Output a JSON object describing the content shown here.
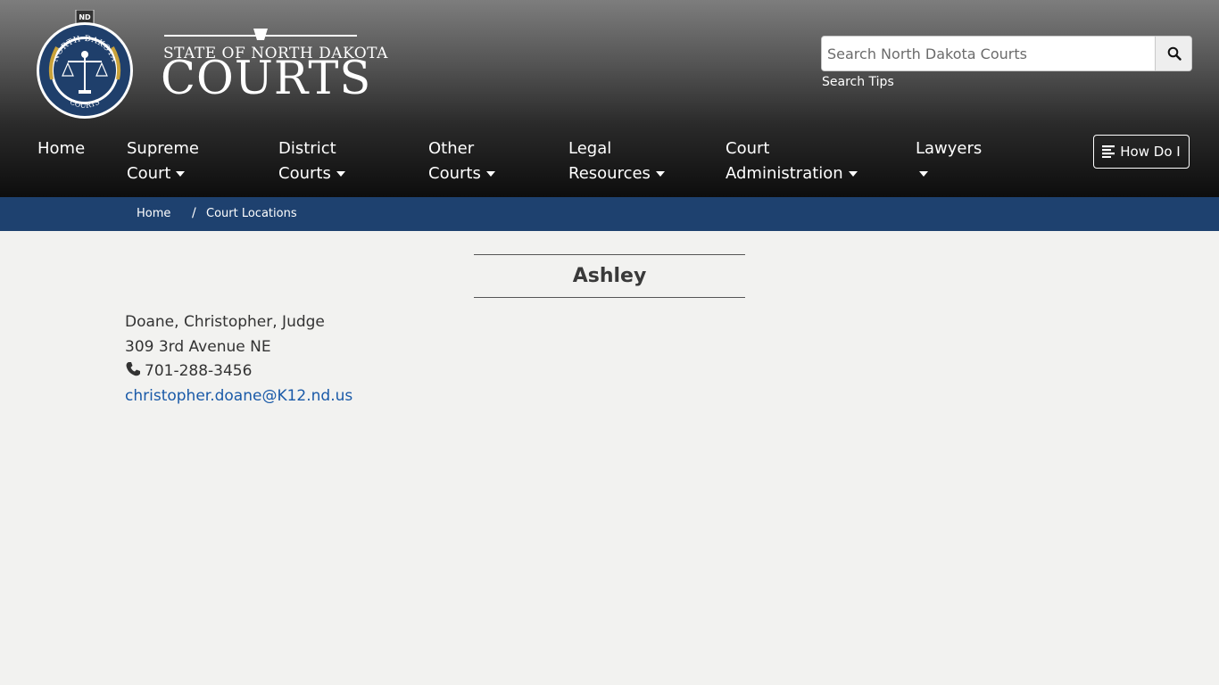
{
  "header": {
    "seal": {
      "top_text": "NORTH DAKOTA",
      "bottom_text": "COURTS",
      "badge": "ND"
    },
    "wordmark": {
      "line1": "STATE OF NORTH DAKOTA",
      "line2": "COURTS"
    },
    "search": {
      "placeholder": "Search North Dakota Courts",
      "button_icon": "search-icon",
      "tips_label": "Search Tips"
    },
    "nav": {
      "home": "Home",
      "supreme_1": "Supreme",
      "supreme_2": "Court",
      "district_1": "District",
      "district_2": "Courts",
      "other_1": "Other",
      "other_2": "Courts",
      "legal_1": "Legal",
      "legal_2": "Resources",
      "court_admin_1": "Court",
      "court_admin_2": "Administration",
      "lawyers": "Lawyers"
    },
    "how_do_i": {
      "label": "How Do I",
      "icon": "align-left-icon"
    }
  },
  "breadcrumb": {
    "home": "Home",
    "separator": "/",
    "current": "Court Locations"
  },
  "main": {
    "title": "Ashley",
    "contact": {
      "name": "Doane, Christopher, Judge",
      "address": "309 3rd Avenue NE",
      "phone_icon": "phone-icon",
      "phone": "701-288-3456",
      "email": "christopher.doane@K12.nd.us"
    }
  },
  "colors": {
    "breadcrumb_bar": "#1e416f",
    "link": "#1a5aa8",
    "seal_blue": "#1f3f6b",
    "seal_gold": "#c9a23a"
  }
}
